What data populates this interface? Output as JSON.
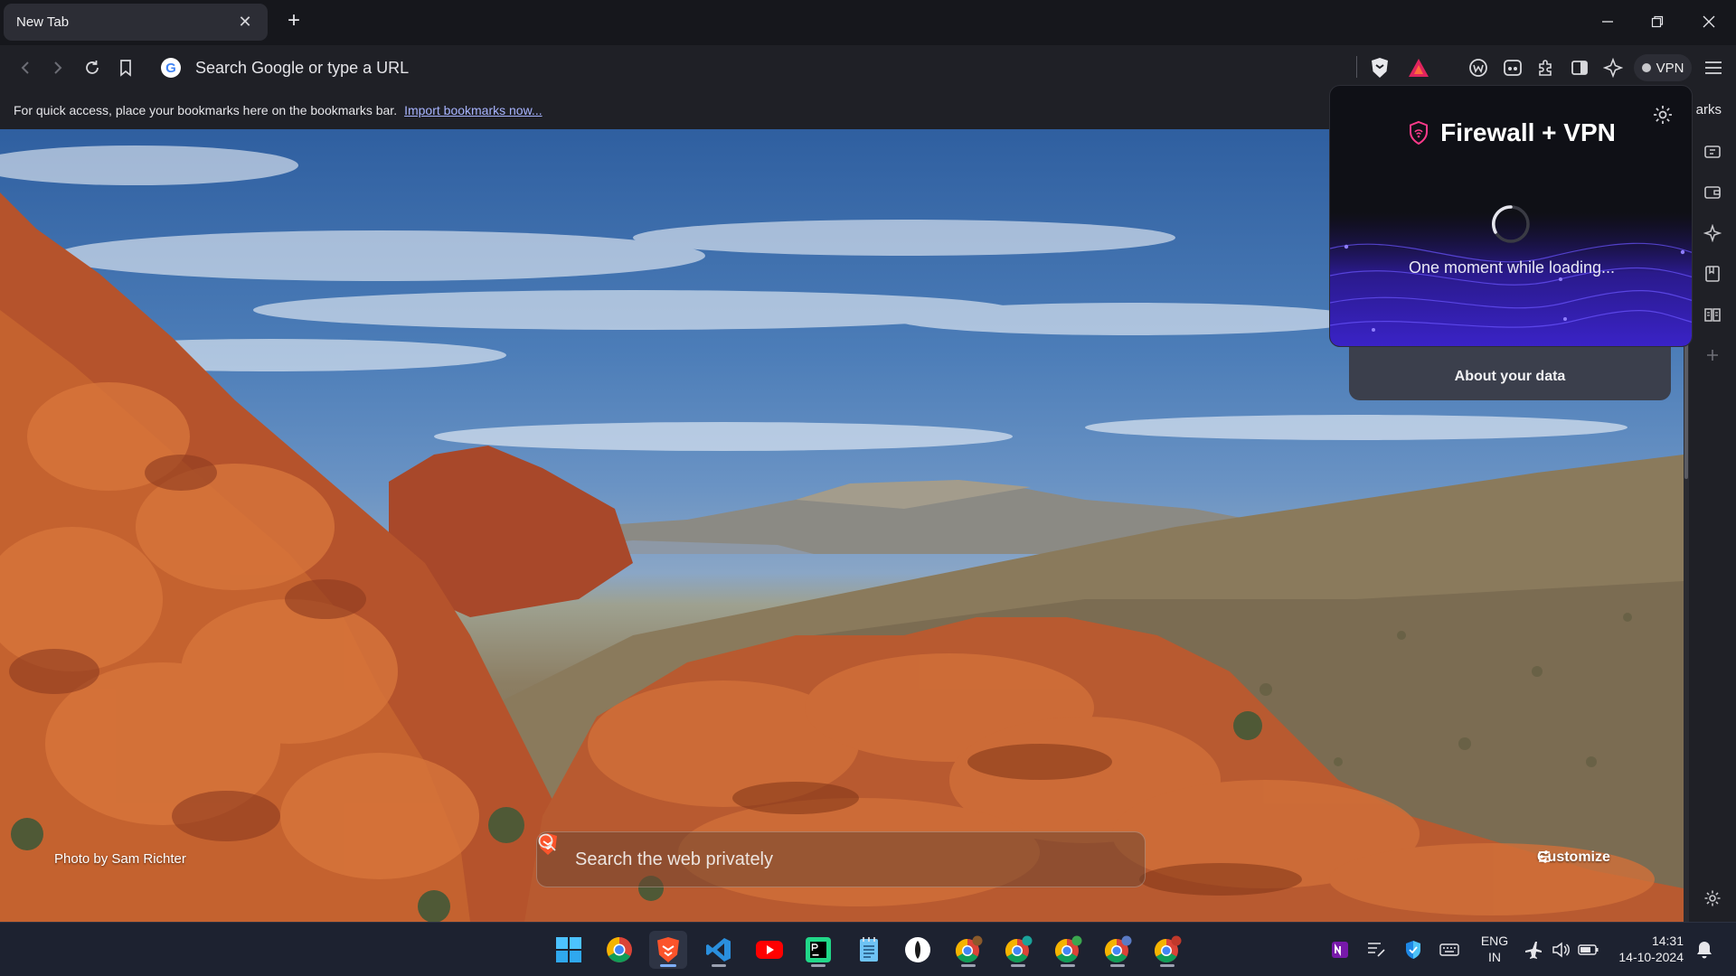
{
  "browser": {
    "tab": {
      "title": "New Tab",
      "close_icon": "close-icon"
    },
    "new_tab_icon": "plus-icon",
    "window_controls": [
      "minimize-icon",
      "restore-icon",
      "close-icon"
    ],
    "address_bar": {
      "placeholder": "Search Google or type a URL",
      "engine_icon": "google-icon",
      "engine_letter": "G"
    },
    "vpn_button": "VPN",
    "bookmarks_bar": {
      "message": "For quick access, place your bookmarks here on the bookmarks bar.",
      "import_link": "Import bookmarks now...",
      "right_label": "arks"
    }
  },
  "new_tab_page": {
    "photo_credit": "Photo by Sam Richter",
    "search_placeholder": "Search the web privately",
    "customize_label": "Customize"
  },
  "vpn_popup": {
    "title": "Firewall + VPN",
    "loading_text": "One moment while loading...",
    "about_label": "About your data"
  },
  "taskbar": {
    "apps": [
      "windows-start-icon",
      "chrome-icon",
      "brave-icon",
      "vscode-icon",
      "youtube-icon",
      "pycharm-icon",
      "notepad-icon",
      "app-icon",
      "chrome-profile-icon",
      "chrome-profile-icon",
      "chrome-profile-icon",
      "chrome-profile-icon",
      "chrome-profile-icon"
    ],
    "language": {
      "line1": "ENG",
      "line2": "IN"
    },
    "clock": {
      "time": "14:31",
      "date": "14-10-2024"
    }
  },
  "colors": {
    "accent_vpn": "#5b3df5",
    "brave_orange": "#fb542b",
    "link": "#a8b4ff"
  }
}
